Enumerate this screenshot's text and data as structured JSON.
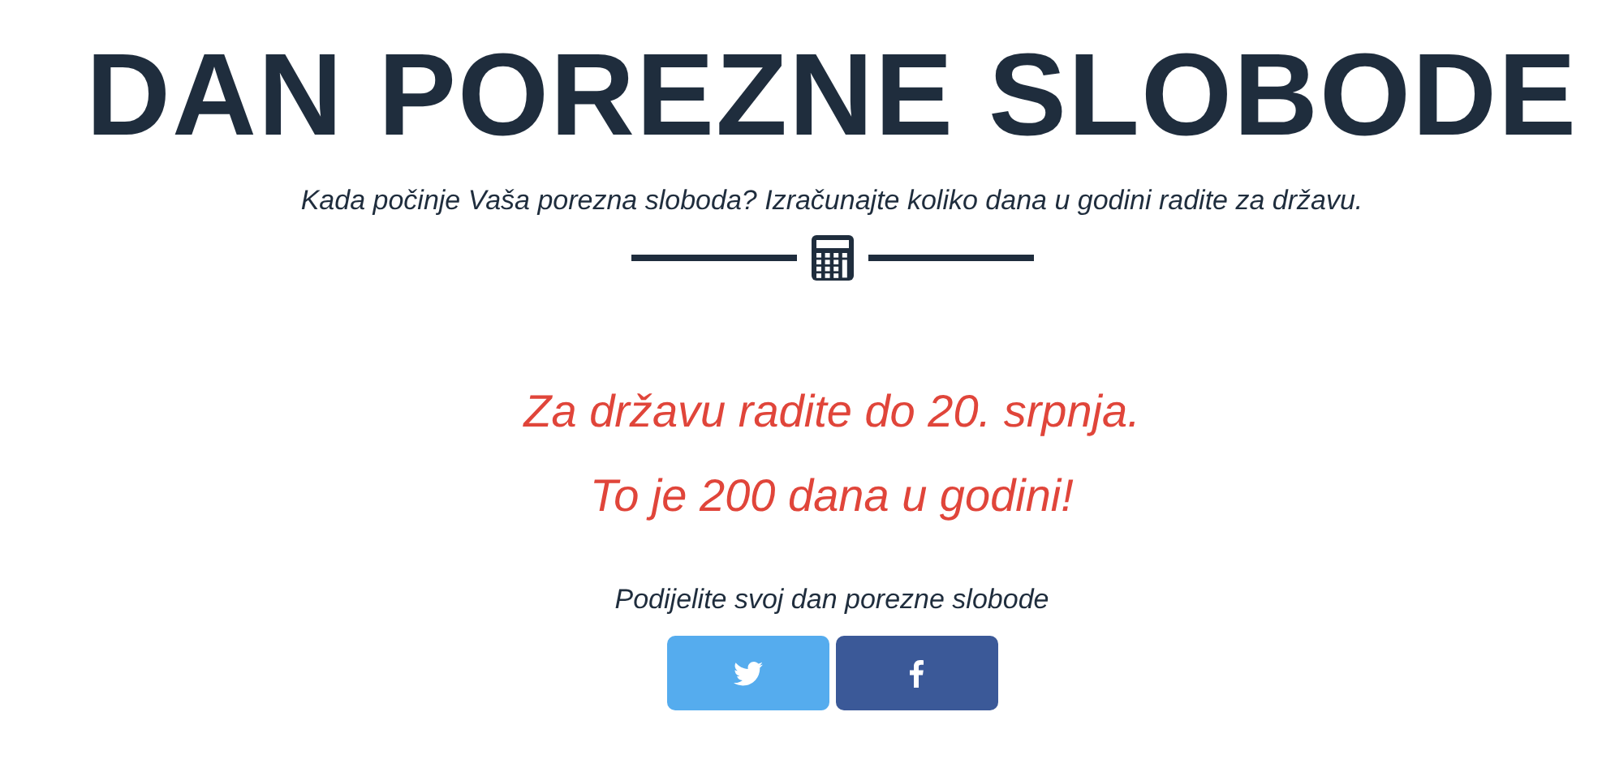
{
  "header": {
    "title": "DAN POREZNE SLOBODE",
    "subtitle": "Kada počinje Vaša porezna sloboda? Izračunajte koliko dana u godini radite za državu."
  },
  "result": {
    "lines": [
      "Za državu radite do 20. srpnja.",
      "To je 200 dana u godini!"
    ]
  },
  "share": {
    "label": "Podijelite svoj dan porezne slobode",
    "buttons": [
      {
        "kind": "twitter"
      },
      {
        "kind": "facebook"
      }
    ]
  }
}
